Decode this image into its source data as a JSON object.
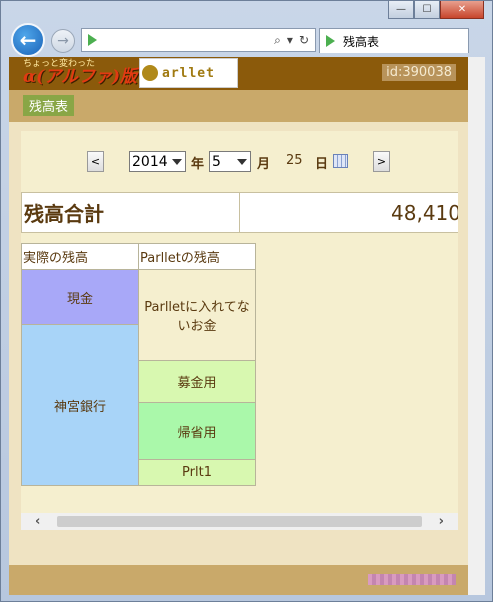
{
  "browser": {
    "tab_title": "残高表",
    "back_symbol": "←",
    "forward_symbol": "→",
    "search_symbol": "⌕",
    "dropdown_symbol": "▾",
    "refresh_symbol": "↻"
  },
  "window_controls": {
    "minimize": "—",
    "maximize": "☐",
    "close": "✕"
  },
  "header": {
    "logo_tagline": "ちょっと変わった",
    "logo_title": "α(アルファ)版",
    "logo_word": "arllet",
    "user_id": "id:390038"
  },
  "subnav": {
    "tab_label": "残高表"
  },
  "date_nav": {
    "prev_label": "<",
    "next_label": ">",
    "year_value": "2014",
    "year_unit": "年",
    "month_value": "5",
    "month_unit": "月",
    "day_value": "25",
    "day_unit": "日"
  },
  "total": {
    "label": "残高合計",
    "value": "48,410"
  },
  "allocation": {
    "actual_header": "実際の残高",
    "parllet_header": "Parlletの残高",
    "actual_rows": [
      {
        "label": "現金",
        "color": "#a8a8f8"
      },
      {
        "label": "神宮銀行",
        "color": "#a8d4f8"
      }
    ],
    "parllet_rows": [
      {
        "label": "Parlletに入れてないお金",
        "color": "#f5efcf"
      },
      {
        "label": "募金用",
        "color": "#d8f8b0"
      },
      {
        "label": "帰省用",
        "color": "#aaf8aa"
      },
      {
        "label": "Prlt1",
        "color": "#d8f8b0"
      }
    ]
  },
  "scrollbar": {
    "left_arrow": "‹",
    "right_arrow": "›"
  }
}
